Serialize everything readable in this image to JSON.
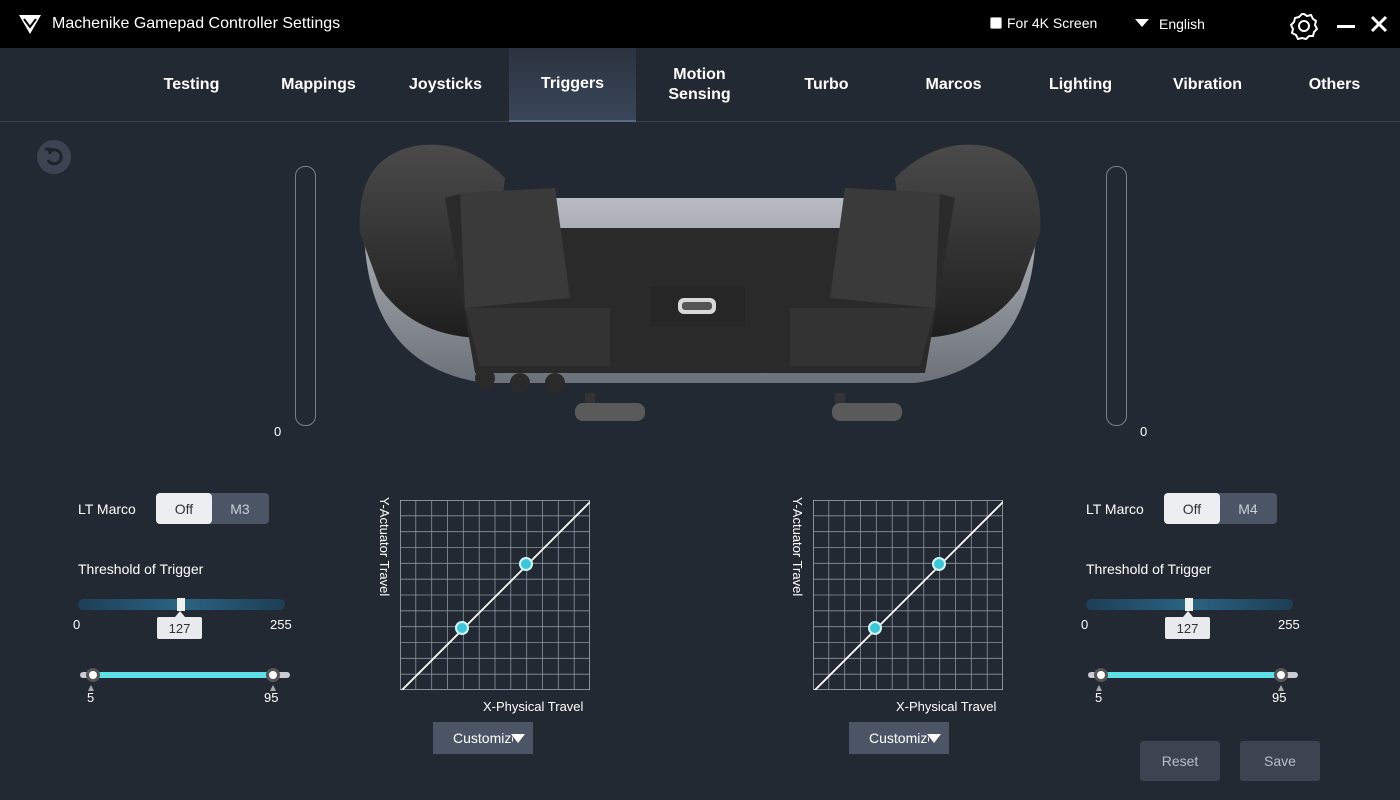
{
  "titlebar": {
    "title": "Machenike Gamepad Controller Settings",
    "checkbox_4k_label": "For 4K Screen",
    "language": "English"
  },
  "nav": {
    "tabs": [
      "Testing",
      "Mappings",
      "Joysticks",
      "Triggers",
      "Motion Sensing",
      "Turbo",
      "Marcos",
      "Lighting",
      "Vibration",
      "Others"
    ],
    "active": "Triggers"
  },
  "left": {
    "trigger_value": "0",
    "marco_label": "LT Marco",
    "marco_off": "Off",
    "marco_macro": "M3",
    "threshold_label": "Threshold of Trigger",
    "threshold_min": "0",
    "threshold_max": "255",
    "threshold_value": "127",
    "range_low": "5",
    "range_high": "95",
    "curve_y_label": "Y-Actuator Travel",
    "curve_x_label": "X-Physical Travel",
    "curve_preset": "Customize"
  },
  "right": {
    "trigger_value": "0",
    "marco_label": "LT Marco",
    "marco_off": "Off",
    "marco_macro": "M4",
    "threshold_label": "Threshold of Trigger",
    "threshold_min": "0",
    "threshold_max": "255",
    "threshold_value": "127",
    "range_low": "5",
    "range_high": "95",
    "curve_y_label": "Y-Actuator Travel",
    "curve_x_label": "X-Physical Travel",
    "curve_preset": "Customize"
  },
  "buttons": {
    "reset": "Reset",
    "save": "Save"
  },
  "colors": {
    "accent": "#5ce0e6",
    "background": "#232932",
    "titlebar": "#000000"
  }
}
